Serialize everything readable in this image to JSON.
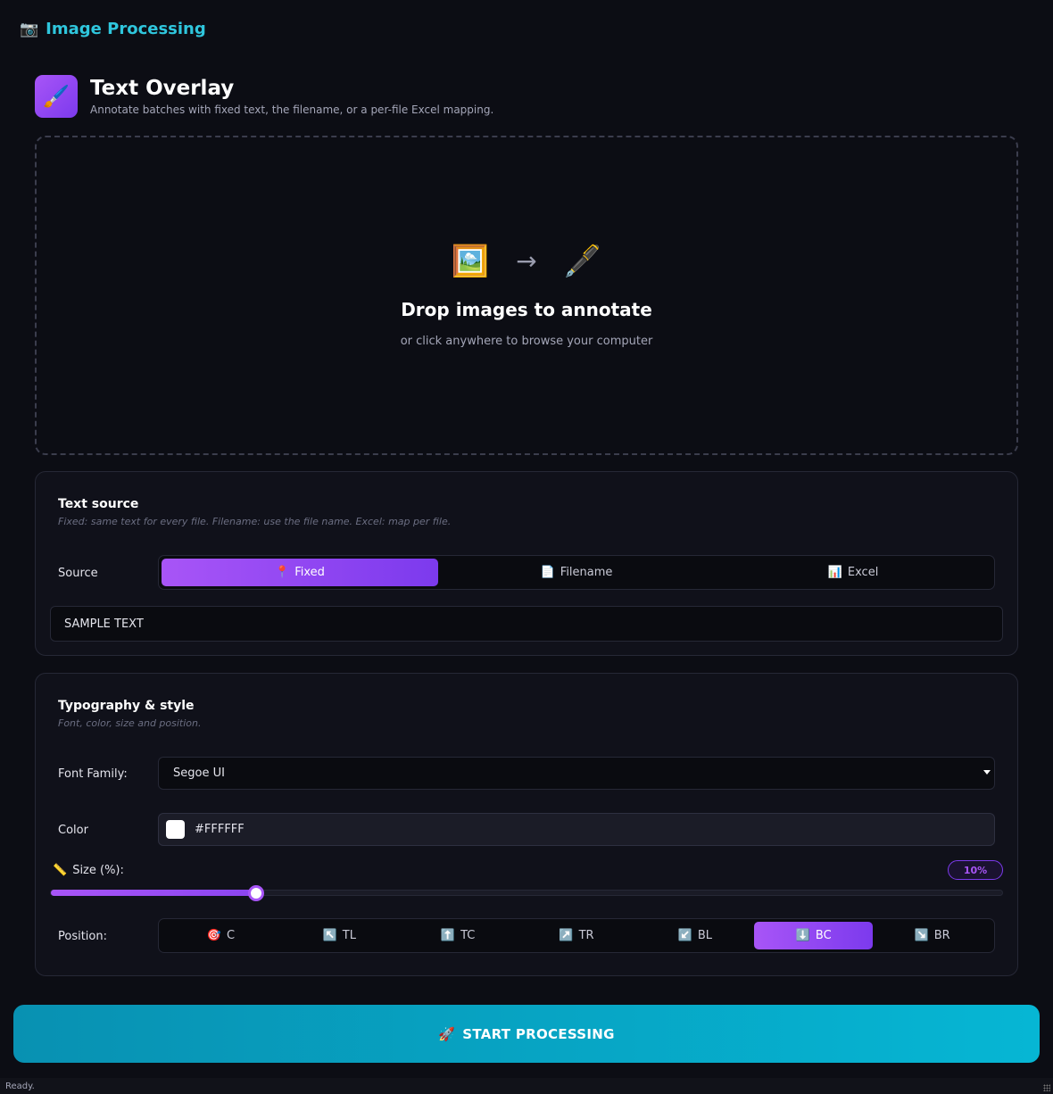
{
  "app": {
    "title": "Image Processing",
    "icon": "camera-icon"
  },
  "header": {
    "title": "Text Overlay",
    "subtitle": "Annotate batches with fixed text, the filename, or a per-file Excel mapping.",
    "icon": "paintbrush-icon"
  },
  "dropzone": {
    "icon_from": "🖼️",
    "arrow": "→",
    "icon_to": "🖋️",
    "title": "Drop images to annotate",
    "subtitle": "or click anywhere to browse your computer"
  },
  "text_source": {
    "title": "Text source",
    "subtitle": "Fixed: same text for every file. Filename: use the file name. Excel: map per file.",
    "source_label": "Source",
    "options": [
      {
        "icon": "📍",
        "label": "Fixed"
      },
      {
        "icon": "📄",
        "label": "Filename"
      },
      {
        "icon": "📊",
        "label": "Excel"
      }
    ],
    "selected": "Fixed",
    "text_value": "SAMPLE TEXT"
  },
  "typography": {
    "title": "Typography & style",
    "subtitle": "Font, color, size and position.",
    "font_family_label": "Font Family:",
    "font_family_value": "Segoe UI",
    "color_label": "Color",
    "color_value": "#FFFFFF",
    "size_icon": "📏",
    "size_label": "Size (%):",
    "size_value": "10%",
    "size_fraction": 0.216,
    "position_label": "Position:",
    "positions": [
      {
        "icon": "🎯",
        "label": "C"
      },
      {
        "icon": "↖️",
        "label": "TL"
      },
      {
        "icon": "⬆️",
        "label": "TC"
      },
      {
        "icon": "↗️",
        "label": "TR"
      },
      {
        "icon": "↙️",
        "label": "BL"
      },
      {
        "icon": "⬇️",
        "label": "BC"
      },
      {
        "icon": "↘️",
        "label": "BR"
      }
    ],
    "selected_position": "BC"
  },
  "cta": {
    "icon": "🚀",
    "label": "START PROCESSING"
  },
  "status": {
    "text": "Ready."
  },
  "colors": {
    "accent": "#a855f7",
    "cta": "#06b6d4",
    "title": "#2fc6dd"
  }
}
